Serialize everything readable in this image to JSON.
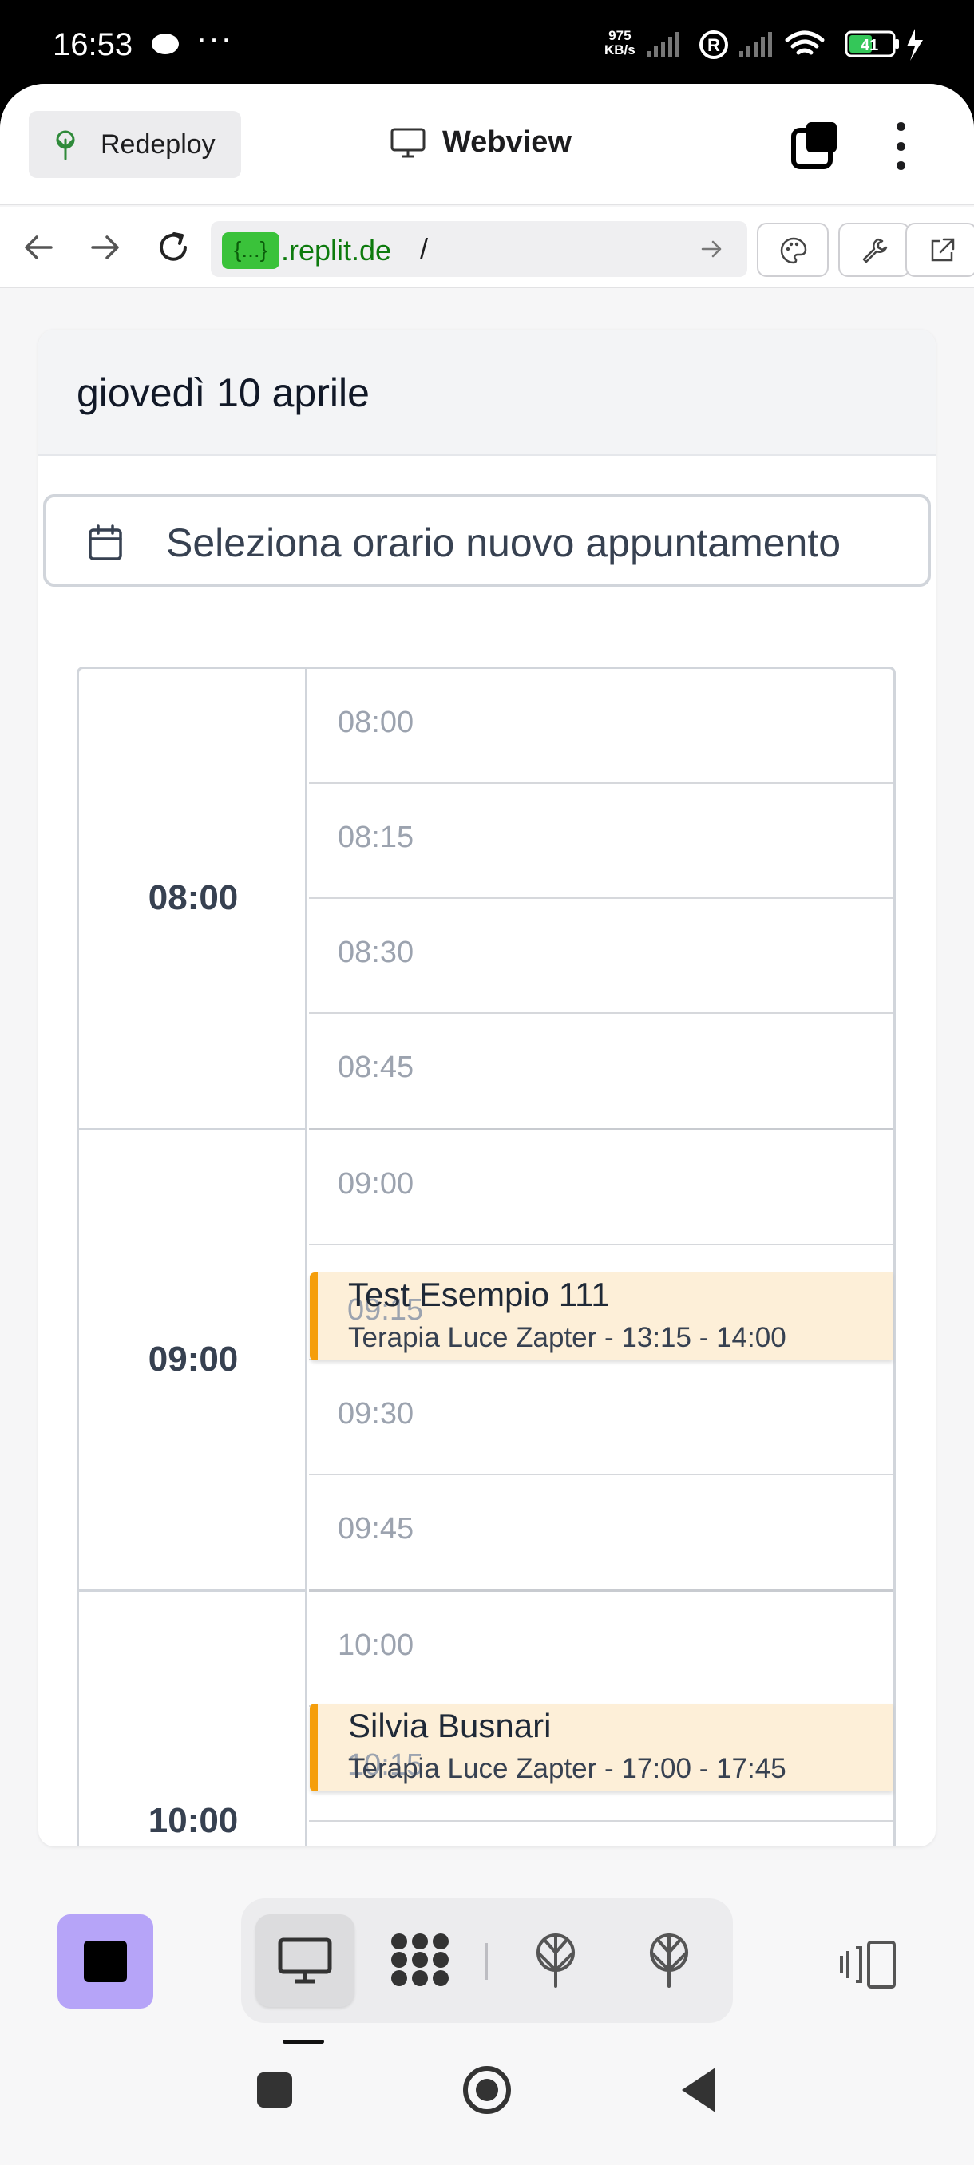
{
  "status_bar": {
    "time": "16:53",
    "net_speed_value": "975",
    "net_speed_unit": "KB/s",
    "battery": "41"
  },
  "app_bar": {
    "redeploy_label": "Redeploy",
    "title": "Webview"
  },
  "url_bar": {
    "badge": "{...}",
    "host": ".replit.de",
    "path": "/"
  },
  "page": {
    "date": "giovedì 10 aprile",
    "select_slot_label": "Seleziona orario nuovo appuntamento",
    "hours": [
      "08:00",
      "09:00",
      "10:00"
    ],
    "slots": [
      "08:00",
      "08:15",
      "08:30",
      "08:45",
      "09:00",
      "09:15",
      "09:30",
      "09:45",
      "10:00",
      "10:15"
    ],
    "events": [
      {
        "name": "Test Esempio 111",
        "detail": "Terapia Luce Zapter - 13:15 - 14:00",
        "slot": "09:15"
      },
      {
        "name": "Silvia Busnari",
        "detail": "Terapia Luce Zapter - 17:00 - 17:45",
        "slot": "10:15"
      }
    ]
  },
  "colors": {
    "accent_event": "#f59e0b",
    "event_bg": "#fdefd8",
    "stop_button": "#b6a4f8",
    "url_green": "#3ac23a"
  }
}
